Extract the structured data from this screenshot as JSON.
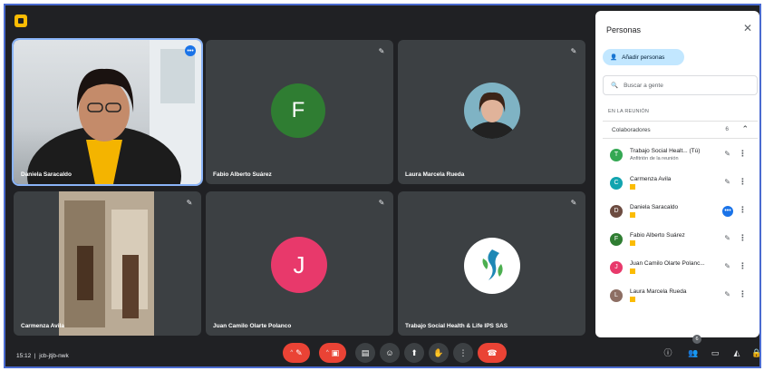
{
  "tiles": [
    {
      "name": "Daniela Saracaldo",
      "type": "camera",
      "active": true
    },
    {
      "name": "Fabio Alberto Suárez",
      "type": "avatar",
      "initial": "F",
      "color": "#2f7d32"
    },
    {
      "name": "Laura Marcela Rueda",
      "type": "photo"
    },
    {
      "name": "Carmenza Avila",
      "type": "camera"
    },
    {
      "name": "Juan Camilo Olarte Polanco",
      "type": "avatar",
      "initial": "J",
      "color": "#e8396b"
    },
    {
      "name": "Trabajo Social Health & Life IPS SAS",
      "type": "logo"
    }
  ],
  "panel": {
    "title": "Personas",
    "add_people_label": "Añadir personas",
    "search_placeholder": "Buscar a gente",
    "section_label": "EN LA REUNIÓN",
    "group_label": "Colaboradores",
    "group_count": "6",
    "people": [
      {
        "name": "Trabajo Social Healt... (Tú)",
        "sub": "Anfitrión de la reunión",
        "color": "#34a853",
        "initial": "T"
      },
      {
        "name": "Carmenza Avila",
        "sub": "",
        "color": "#12a4af",
        "initial": "C"
      },
      {
        "name": "Daniela Saracaldo",
        "sub": "",
        "color": "#6d4c41",
        "initial": "D",
        "speaking": true
      },
      {
        "name": "Fabio Alberto Suárez",
        "sub": "",
        "color": "#2f7d32",
        "initial": "F"
      },
      {
        "name": "Juan Camilo Olarte Polanc...",
        "sub": "",
        "color": "#e8396b",
        "initial": "J"
      },
      {
        "name": "Laura Marcela Rueda",
        "sub": "",
        "color": "#8d6e63",
        "initial": "L"
      }
    ]
  },
  "bottom_bar": {
    "time": "15:12",
    "meeting_code": "jcb-jtjb-nwk",
    "people_count": "6"
  },
  "colors": {
    "background": "#202124",
    "tile": "#3c4043",
    "end_call": "#ea4335",
    "accent": "#1a73e8"
  }
}
